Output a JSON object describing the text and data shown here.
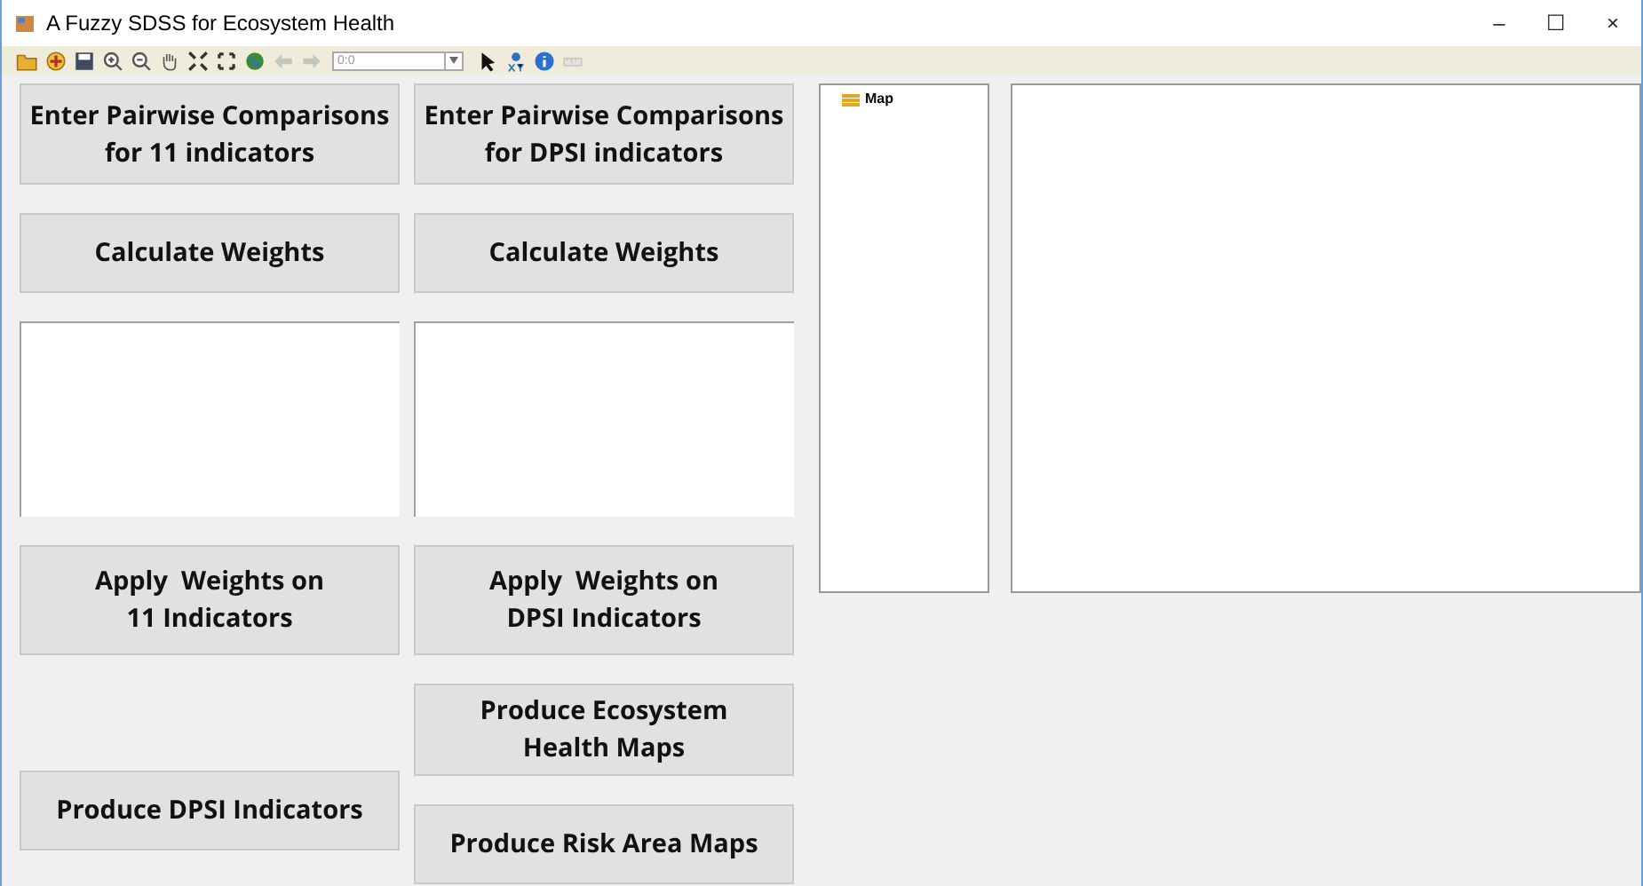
{
  "window": {
    "title": "A Fuzzy SDSS for Ecosystem Health",
    "controls": [
      "–",
      "☐",
      "×"
    ]
  },
  "toolbar": [
    {
      "kind": "folder"
    },
    {
      "kind": "add"
    },
    {
      "kind": "save"
    },
    {
      "kind": "zoomin"
    },
    {
      "kind": "zoomout"
    },
    {
      "kind": "hand"
    },
    {
      "kind": "shrink"
    },
    {
      "kind": "expand"
    },
    {
      "kind": "globe"
    },
    {
      "kind": "back",
      "disabled": true
    },
    {
      "kind": "forward",
      "disabled": true
    },
    {
      "kind": "combo",
      "value": "0:0",
      "disabled": true
    },
    {
      "kind": "pointer"
    },
    {
      "kind": "xy"
    },
    {
      "kind": "info"
    },
    {
      "kind": "measure",
      "disabled": true
    }
  ],
  "columns": [
    [
      {
        "kind": "button",
        "label": "Enter Pairwise Comparisons\nfor 11 indicators"
      },
      {
        "kind": "button",
        "label": "Calculate Weights"
      },
      {
        "kind": "textarea"
      },
      {
        "kind": "button",
        "label": "Apply  Weights on\n11 Indicators"
      },
      {
        "kind": "spacer"
      },
      {
        "kind": "button",
        "label": "Produce DPSI Indicators"
      }
    ],
    [
      {
        "kind": "button",
        "label": "Enter Pairwise Comparisons\nfor DPSI indicators"
      },
      {
        "kind": "button",
        "label": "Calculate Weights"
      },
      {
        "kind": "textarea"
      },
      {
        "kind": "button",
        "label": "Apply  Weights on\nDPSI Indicators"
      },
      {
        "kind": "button",
        "label": "Produce Ecosystem\nHealth Maps"
      },
      {
        "kind": "button",
        "label": "Produce Risk Area Maps"
      }
    ]
  ],
  "legend": {
    "items": [
      {
        "label": "Map"
      }
    ]
  }
}
